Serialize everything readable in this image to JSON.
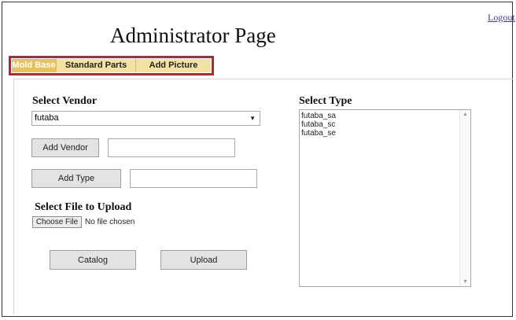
{
  "header": {
    "logout_label": "Logout",
    "page_title": "Administrator Page"
  },
  "tabs": [
    {
      "label": "Mold Base",
      "active": true
    },
    {
      "label": "Standard Parts",
      "active": false
    },
    {
      "label": "Add Picture",
      "active": false
    }
  ],
  "vendor": {
    "heading": "Select Vendor",
    "selected": "futaba",
    "add_vendor_label": "Add Vendor",
    "add_vendor_value": "",
    "add_type_label": "Add Type",
    "add_type_value": ""
  },
  "upload": {
    "heading": "Select File to Upload",
    "choose_file_label": "Choose File",
    "file_status": "No file chosen",
    "catalog_label": "Catalog",
    "upload_label": "Upload"
  },
  "type": {
    "heading": "Select Type",
    "options": [
      "futaba_sa",
      "futaba_sc",
      "futaba_se"
    ]
  },
  "colors": {
    "tab_active": "#e8c35d",
    "tab_inactive": "#f3e2a4",
    "highlight_border": "#c8202a",
    "link": "#4a3a8a"
  },
  "icons": {
    "dropdown": "chevron-down-icon",
    "scroll_up": "scroll-up-arrow-icon",
    "scroll_down": "scroll-down-arrow-icon"
  }
}
